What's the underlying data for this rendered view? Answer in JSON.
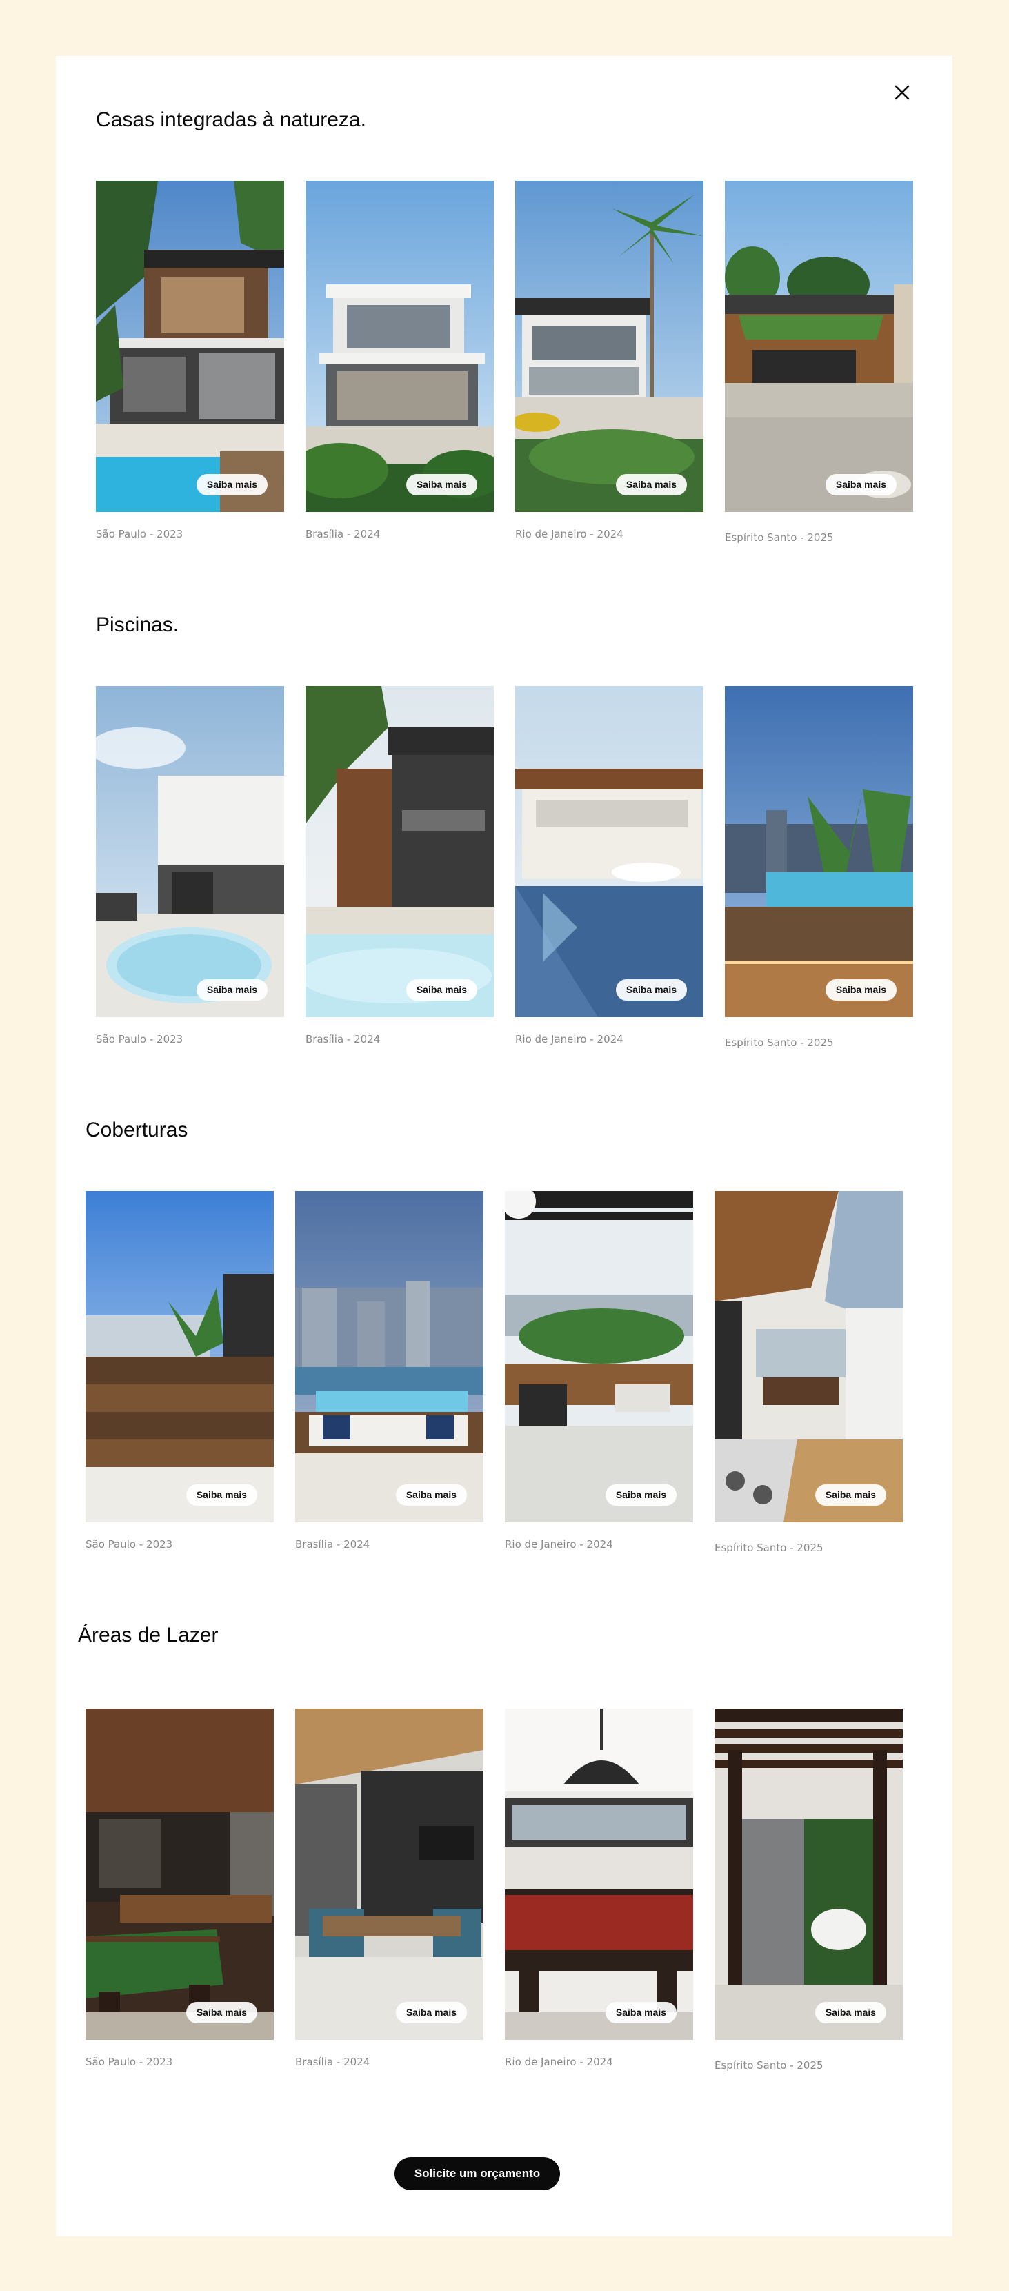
{
  "modal": {
    "close_icon": "close-icon",
    "cta_label": "Solicite um orçamento",
    "button_label": "Saiba mais"
  },
  "colors": {
    "page_background": "#FDF4E1",
    "card_background": "#FFFFFF",
    "cta_background": "#0B0B0B",
    "caption_text": "#8A8A8A"
  },
  "sections": [
    {
      "title": "Casas integradas à natureza.",
      "items": [
        {
          "caption": "São Paulo - 2023",
          "button": "Saiba mais",
          "scene": "modern-house-pool-palms"
        },
        {
          "caption": "Brasília - 2024",
          "button": "Saiba mais",
          "scene": "white-modern-house-garden"
        },
        {
          "caption": "Rio de Janeiro - 2024",
          "button": "Saiba mais",
          "scene": "modern-house-palm-tree"
        },
        {
          "caption": "Espírito Santo - 2025",
          "button": "Saiba mais",
          "scene": "wood-facade-house-garage"
        }
      ]
    },
    {
      "title": "Piscinas.",
      "items": [
        {
          "caption": "São Paulo - 2023",
          "button": "Saiba mais",
          "scene": "rooftop-jacuzzi"
        },
        {
          "caption": "Brasília - 2024",
          "button": "Saiba mais",
          "scene": "pool-with-outdoor-kitchen"
        },
        {
          "caption": "Rio de Janeiro - 2024",
          "button": "Saiba mais",
          "scene": "pool-with-pergola-dining"
        },
        {
          "caption": "Espírito Santo - 2025",
          "button": "Saiba mais",
          "scene": "rooftop-pool-city-view"
        }
      ]
    },
    {
      "title": "Coberturas",
      "items": [
        {
          "caption": "São Paulo - 2023",
          "button": "Saiba mais",
          "scene": "rooftop-wood-deck"
        },
        {
          "caption": "Brasília - 2024",
          "button": "Saiba mais",
          "scene": "rooftop-jacuzzi-sofa"
        },
        {
          "caption": "Rio de Janeiro - 2024",
          "button": "Saiba mais",
          "scene": "rooftop-pergola-lounge"
        },
        {
          "caption": "Espírito Santo - 2025",
          "button": "Saiba mais",
          "scene": "covered-terrace-dining"
        }
      ]
    },
    {
      "title": "Áreas de Lazer",
      "items": [
        {
          "caption": "São Paulo - 2023",
          "button": "Saiba mais",
          "scene": "game-room-pool-table-green"
        },
        {
          "caption": "Brasília - 2024",
          "button": "Saiba mais",
          "scene": "gourmet-dining-space"
        },
        {
          "caption": "Rio de Janeiro - 2024",
          "button": "Saiba mais",
          "scene": "game-room-pool-table-red"
        },
        {
          "caption": "Espírito Santo - 2025",
          "button": "Saiba mais",
          "scene": "pergola-swing-vertical-garden"
        }
      ]
    }
  ]
}
